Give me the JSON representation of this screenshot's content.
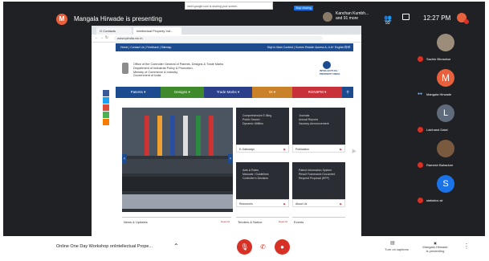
{
  "topbar": {
    "presenter_initial": "M",
    "presenting_text": "Mangala Hirwade is presenting",
    "participant_summary_line1": "Kanchan Kumbh...",
    "participant_summary_line2": "and 91 more",
    "people_count": "93",
    "clock": "12:27 PM"
  },
  "browser": {
    "tab1": "G Contacts",
    "tab2": "Intellectual Property Ind...",
    "url": "www.ipindia.nic.in",
    "share_notice": "meet.google.com is sharing your screen.",
    "stop_sharing": "Stop sharing"
  },
  "site": {
    "toplinks": "Home | Contact Us | Feedback | Sitemap",
    "toplinks_right": "Skip to Main Content | Screen Reader Access  A- A  A+  English  हिन्दी",
    "office_line1": "Office of the Controller General of Patents, Designs & Trade Marks",
    "office_line2": "Department of Industrial Policy & Promotion,",
    "office_line3": "Ministry of Commerce & Industry,",
    "office_line4": "Government of India",
    "logo_line1": "INTELLECTUAL",
    "logo_line2": "PROPERTY INDIA",
    "menu": [
      "Patents ▾",
      "Designs ▾",
      "Trade Marks ▾",
      "GI ▾",
      "RGNIIPM ▾"
    ],
    "menu_colors": [
      "#1d4b8f",
      "#3f8a2a",
      "#2b3f8a",
      "#c9822a",
      "#c8313a",
      "#1d4b8f"
    ],
    "tiles": [
      {
        "text": "Comprehensive E-filing\nPublic Search\nDynamic Utilities",
        "foot": "E-Gateways"
      },
      {
        "text": "Journals\nAnnual Reports\nVacancy Announcement",
        "foot": "Publication"
      },
      {
        "text": "Acts & Rules\nManuals / Guidelines\nController's Decision",
        "foot": "Resources"
      },
      {
        "text": "Patent Information System\nResult Framework Document\nRequest Proposal (RFP)",
        "foot": "About Us"
      }
    ],
    "news": [
      {
        "title": "News & Updates",
        "more": "Read All"
      },
      {
        "title": "Tenders & Notice",
        "more": "Read All"
      },
      {
        "title": "Events",
        "more": ""
      }
    ]
  },
  "participants": [
    {
      "name": "Sachin Bhosekar",
      "muted": true
    },
    {
      "name": "Mangala Hirwade",
      "initial": "M",
      "muted": false
    },
    {
      "name": "Lalchand Dalal",
      "initial": "L",
      "muted": true
    },
    {
      "name": "Ramesh Bahadure",
      "muted": true
    },
    {
      "name": "statistics sir",
      "initial": "S",
      "muted": true
    }
  ],
  "bottombar": {
    "meeting_title": "Online One Day Workshop onIntellectual Prope...",
    "captions_line1": "Turn on captions",
    "presenting_line1": "Mangala Hirwade",
    "presenting_line2": "is presenting"
  }
}
